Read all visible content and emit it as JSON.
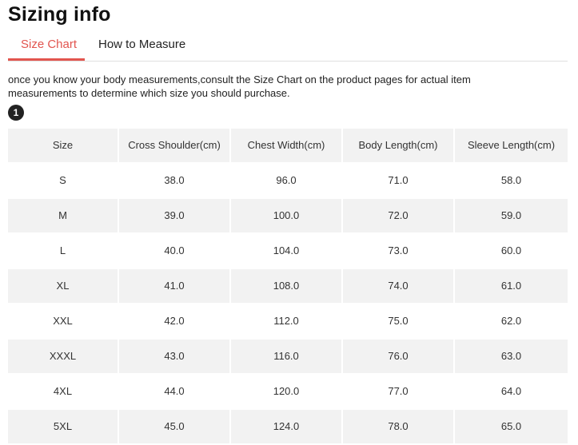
{
  "header": {
    "title": "Sizing info"
  },
  "tabs": [
    {
      "label": "Size Chart",
      "active": true
    },
    {
      "label": "How to Measure",
      "active": false
    }
  ],
  "colors": {
    "accent": "#e2554f",
    "row_shade": "#f2f2f2"
  },
  "note": "once you know your body measurements,consult the Size Chart on the product pages for actual item measurements to determine which size you should purchase.",
  "step_badge": "1",
  "table": {
    "headers": [
      "Size",
      "Cross Shoulder(cm)",
      "Chest Width(cm)",
      "Body Length(cm)",
      "Sleeve Length(cm)"
    ],
    "rows": [
      [
        "S",
        "38.0",
        "96.0",
        "71.0",
        "58.0"
      ],
      [
        "M",
        "39.0",
        "100.0",
        "72.0",
        "59.0"
      ],
      [
        "L",
        "40.0",
        "104.0",
        "73.0",
        "60.0"
      ],
      [
        "XL",
        "41.0",
        "108.0",
        "74.0",
        "61.0"
      ],
      [
        "XXL",
        "42.0",
        "112.0",
        "75.0",
        "62.0"
      ],
      [
        "XXXL",
        "43.0",
        "116.0",
        "76.0",
        "63.0"
      ],
      [
        "4XL",
        "44.0",
        "120.0",
        "77.0",
        "64.0"
      ],
      [
        "5XL",
        "45.0",
        "124.0",
        "78.0",
        "65.0"
      ]
    ]
  }
}
